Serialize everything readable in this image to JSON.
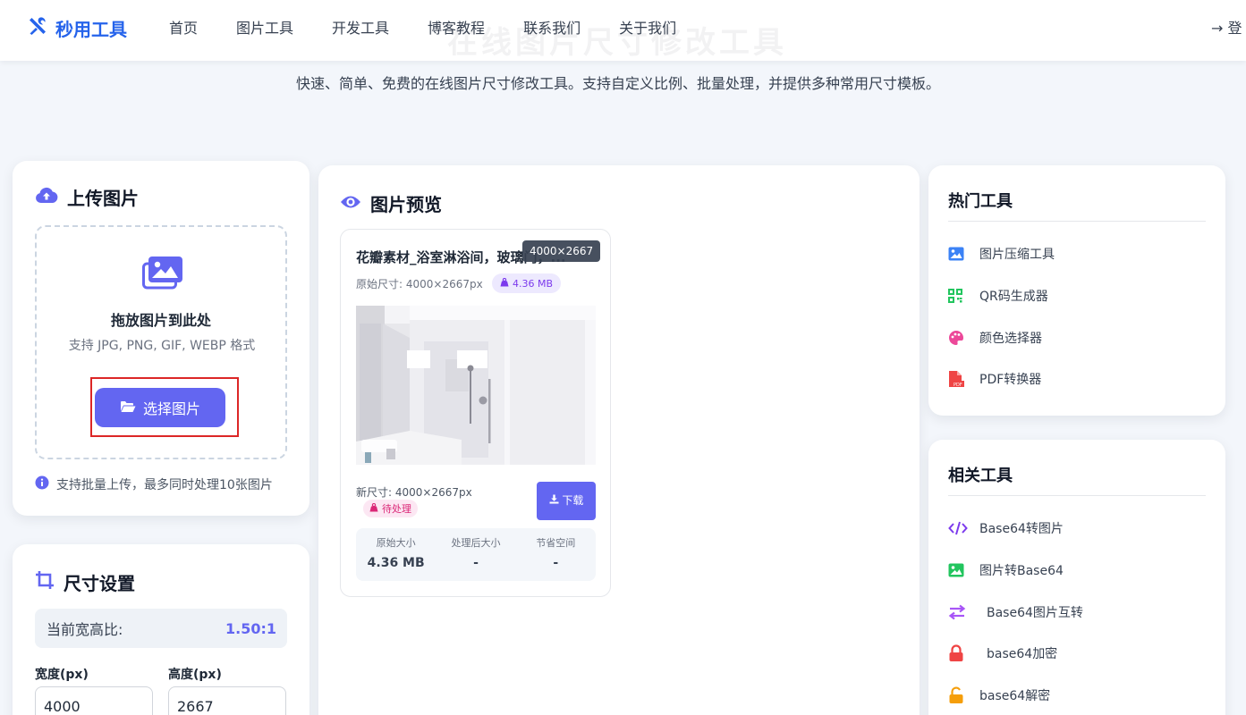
{
  "brand": {
    "name": "秒用工具",
    "icon": "tools-icon",
    "color": "#2563eb"
  },
  "nav": [
    "首页",
    "图片工具",
    "开发工具",
    "博客教程",
    "联系我们",
    "关于我们"
  ],
  "login": "→ 登",
  "hero": {
    "title": "在线图片尺寸修改工具",
    "subtitle": "快速、简单、免费的在线图片尺寸修改工具。支持自定义比例、批量处理，并提供多种常用尺寸模板。"
  },
  "upload": {
    "title": "上传图片",
    "drop_title": "拖放图片到此处",
    "drop_hint": "支持 JPG, PNG, GIF, WEBP 格式",
    "select_button": "选择图片",
    "batch_note": "支持批量上传，最多同时处理10张图片"
  },
  "size_settings": {
    "title": "尺寸设置",
    "ratio_label": "当前宽高比:",
    "ratio_value": "1.50:1",
    "width_label": "宽度(px)",
    "width_value": "4000",
    "height_label": "高度(px)",
    "height_value": "2667"
  },
  "preview": {
    "title": "图片预览",
    "items": [
      {
        "name": "花瓣素材_浴室淋浴间，玻璃门，...",
        "tooltip": "4000×2667",
        "original_size": "原始尺寸: 4000×2667px",
        "file_size": "4.36 MB",
        "new_size": "新尺寸: 4000×2667px",
        "status": "待处理",
        "download_label": "下载",
        "stats": [
          {
            "label": "原始大小",
            "value": "4.36 MB"
          },
          {
            "label": "处理后大小",
            "value": "-"
          },
          {
            "label": "节省空间",
            "value": "-"
          }
        ]
      }
    ]
  },
  "hot_tools": {
    "title": "热门工具",
    "items": [
      {
        "label": "图片压缩工具",
        "icon": "image-icon",
        "color": "#3b82f6"
      },
      {
        "label": "QR码生成器",
        "icon": "qrcode-icon",
        "color": "#22c55e"
      },
      {
        "label": "颜色选择器",
        "icon": "palette-icon",
        "color": "#ec4899"
      },
      {
        "label": "PDF转换器",
        "icon": "pdf-icon",
        "color": "#ef4444"
      }
    ]
  },
  "related_tools": {
    "title": "相关工具",
    "items": [
      {
        "label": "Base64转图片",
        "icon": "code-icon",
        "color": "#7c3aed"
      },
      {
        "label": "图片转Base64",
        "icon": "image-icon",
        "color": "#22c55e"
      },
      {
        "label": "Base64图片互转",
        "icon": "exchange-icon",
        "color": "#a855f7"
      },
      {
        "label": "base64加密",
        "icon": "lock-icon",
        "color": "#ef4444"
      },
      {
        "label": "base64解密",
        "icon": "unlock-icon",
        "color": "#f59e0b"
      }
    ]
  },
  "colors": {
    "accent": "#6366f1",
    "background": "#f3f6fb"
  }
}
